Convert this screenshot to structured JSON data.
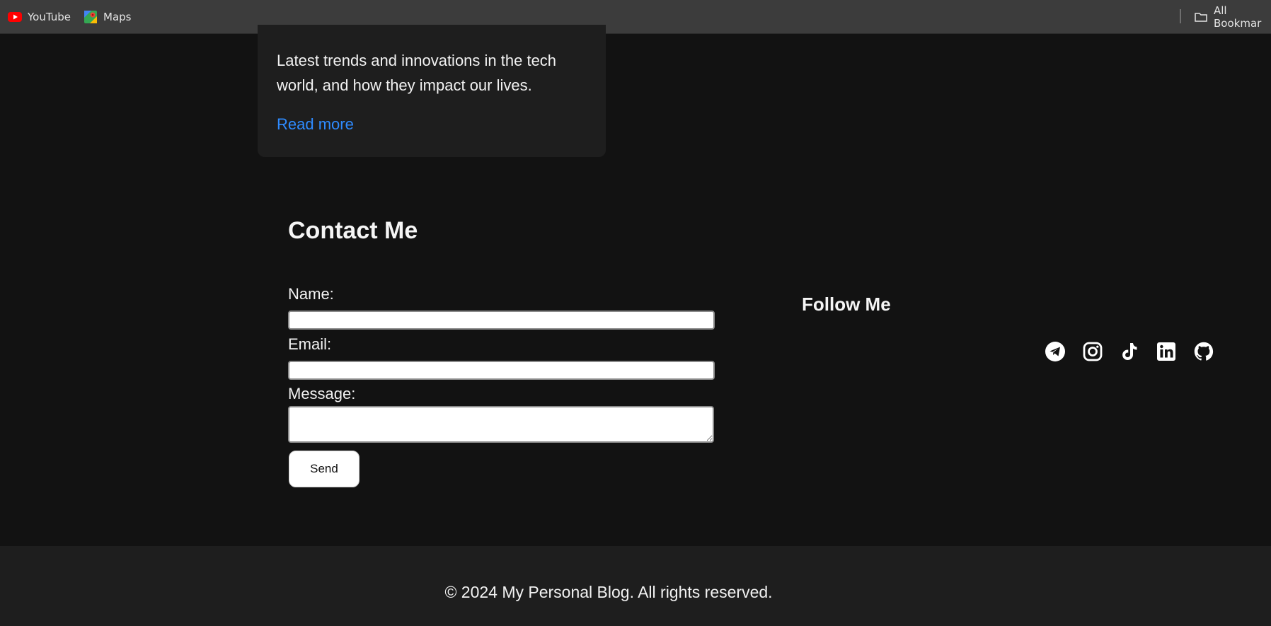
{
  "bookmarks": {
    "items": [
      {
        "label": "YouTube",
        "icon": "youtube-icon"
      },
      {
        "label": "Maps",
        "icon": "maps-icon"
      }
    ],
    "all_bookmarks_label": "All Bookmar"
  },
  "post": {
    "excerpt": "Latest trends and innovations in the tech world, and how they impact our lives.",
    "read_more": "Read more"
  },
  "contact": {
    "title": "Contact Me",
    "name_label": "Name:",
    "name_value": "",
    "email_label": "Email:",
    "email_value": "",
    "message_label": "Message:",
    "message_value": "",
    "send_label": "Send"
  },
  "follow": {
    "title": "Follow Me",
    "icons": [
      "telegram-icon",
      "instagram-icon",
      "tiktok-icon",
      "linkedin-icon",
      "github-icon"
    ]
  },
  "footer": {
    "copyright": "© 2024 My Personal Blog. All rights reserved."
  },
  "colors": {
    "background": "#121212",
    "card": "#1e1e1e",
    "link": "#2e8bff",
    "bookmarks_bar": "#3c3c3c"
  }
}
